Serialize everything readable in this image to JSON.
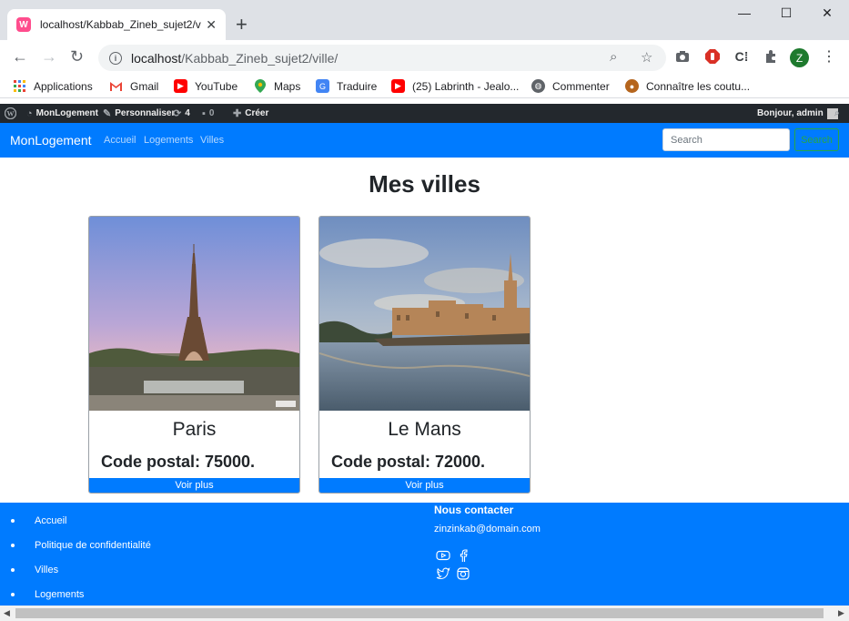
{
  "browser": {
    "tab_title": "localhost/Kabbab_Zineb_sujet2/v",
    "favicon_letter": "W",
    "url_host": "localhost",
    "url_path": "/Kabbab_Zineb_sujet2/ville/",
    "profile_initial": "Z",
    "bookmarks": [
      {
        "label": "Applications",
        "icon": "apps-grid-icon"
      },
      {
        "label": "Gmail",
        "icon": "gmail-icon"
      },
      {
        "label": "YouTube",
        "icon": "youtube-icon"
      },
      {
        "label": "Maps",
        "icon": "maps-icon"
      },
      {
        "label": "Traduire",
        "icon": "translate-icon"
      },
      {
        "label": "(25) Labrinth - Jealo...",
        "icon": "youtube-icon"
      },
      {
        "label": "Commenter",
        "icon": "globe-icon"
      },
      {
        "label": "Connaître les coutu...",
        "icon": "site-icon"
      }
    ]
  },
  "wp_admin_bar": {
    "site": "MonLogement",
    "customize": "Personnaliser",
    "updates_count": "4",
    "comments_count": "0",
    "new": "Créer",
    "greeting": "Bonjour, admin"
  },
  "site_nav": {
    "brand": "MonLogement",
    "links": [
      "Accueil",
      "Logements",
      "Villes"
    ],
    "search_placeholder": "Search",
    "search_button": "Search"
  },
  "page": {
    "title": "Mes villes",
    "cities": [
      {
        "name": "Paris",
        "postal": "Code postal: 75000.",
        "button": "Voir plus"
      },
      {
        "name": "Le Mans",
        "postal": "Code postal: 72000.",
        "button": "Voir plus"
      }
    ]
  },
  "footer": {
    "links": [
      "Accueil",
      "Politique de confidentialité",
      "Villes",
      "Logements"
    ],
    "contact_title": "Nous contacter",
    "email": "zinzinkab@domain.com"
  },
  "colors": {
    "primary": "#007bff",
    "wp_bar": "#23282d",
    "success": "#28a745"
  }
}
